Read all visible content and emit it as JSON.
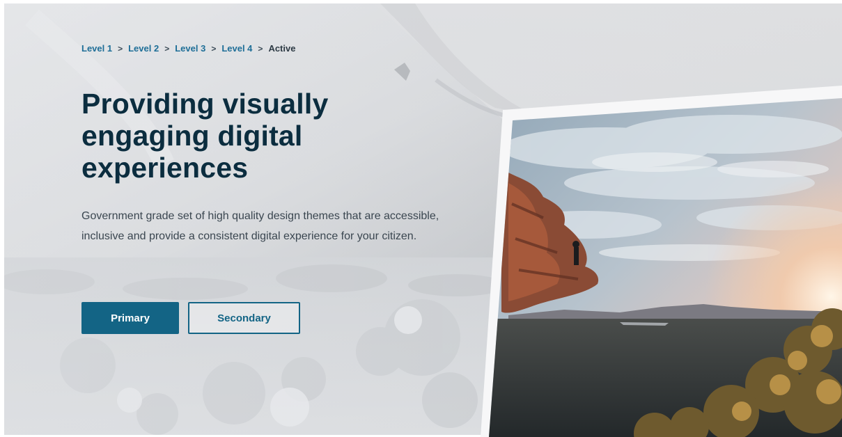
{
  "breadcrumb": {
    "items": [
      "Level 1",
      "Level 2",
      "Level 3",
      "Level 4"
    ],
    "separator": ">",
    "active": "Active"
  },
  "hero": {
    "title_lines": [
      "Providing visually",
      "engaging digital",
      "experiences"
    ],
    "description": "Government grade set of high quality design themes that are accessible, inclusive and provide a consistent digital experience for your citizen.",
    "primary_label": "Primary",
    "secondary_label": "Secondary"
  },
  "colors": {
    "primary": "#136485",
    "title": "#0b2d3f",
    "link": "#1e6e97"
  }
}
